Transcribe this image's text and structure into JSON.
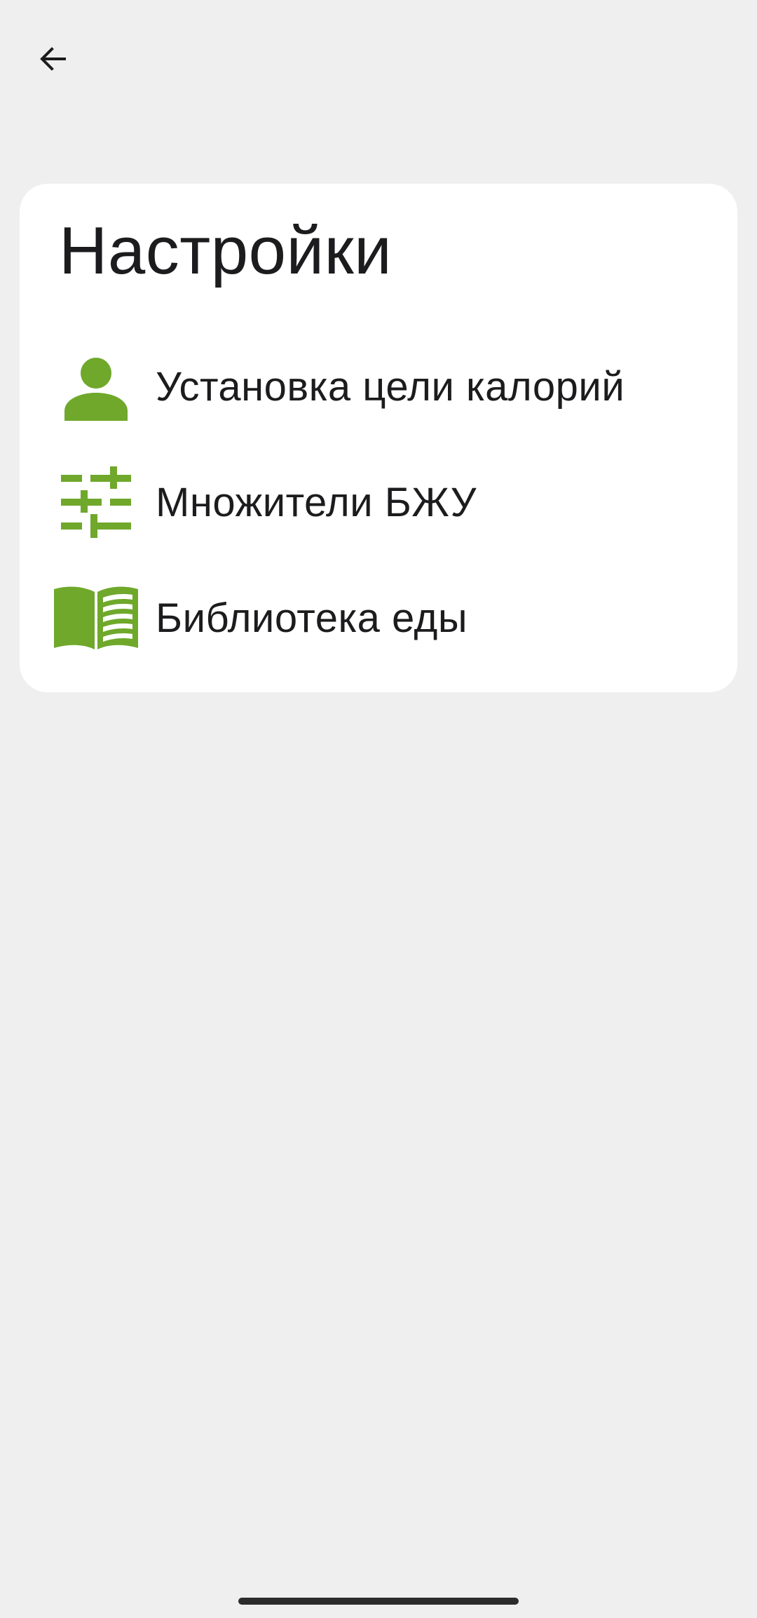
{
  "header": {
    "back_icon": "arrow-left-icon"
  },
  "settings": {
    "title": "Настройки",
    "accent_color": "#6fa82b",
    "items": [
      {
        "label": "Установка цели калорий",
        "icon": "person-icon"
      },
      {
        "label": "Множители БЖУ",
        "icon": "sliders-icon"
      },
      {
        "label": "Библиотека еды",
        "icon": "open-book-icon"
      }
    ]
  }
}
